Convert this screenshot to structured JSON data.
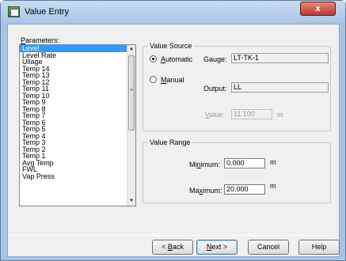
{
  "window": {
    "title": "Value Entry",
    "close_label": "x"
  },
  "parameters": {
    "label": "Parameters:",
    "items": [
      "Level",
      "Level Rate",
      "Ullage",
      "Temp 14",
      "Temp 13",
      "Temp 12",
      "Temp 11",
      "Temp 10",
      "Temp 9",
      "Temp 8",
      "Temp 7",
      "Temp 6",
      "Temp 5",
      "Temp 4",
      "Temp 3",
      "Temp 2",
      "Temp 1",
      "Avg Temp",
      "FWL",
      "Vap Press"
    ],
    "selected": "Level"
  },
  "value_source": {
    "title": "Value Source",
    "automatic_label": "Automatic",
    "automatic_selected": true,
    "manual_label": "Manual",
    "gauge_label": "Gauge:",
    "gauge_value": "LT-TK-1",
    "output_label": "Output:",
    "output_value": "LL",
    "value_label": "Value:",
    "value_value": "11.100",
    "value_unit": "m"
  },
  "value_range": {
    "title": "Value Range",
    "minimum_label": "Minimum:",
    "minimum_value": "0.000",
    "minimum_unit": "m",
    "maximum_label": "Maximum:",
    "maximum_value": "20.000",
    "maximum_unit": "m"
  },
  "buttons": {
    "back": "< Back",
    "next": "Next >",
    "cancel": "Cancel",
    "help": "Help"
  }
}
